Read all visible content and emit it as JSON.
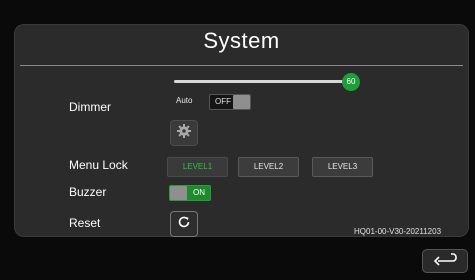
{
  "header": {
    "title": "System"
  },
  "dimmer": {
    "label": "Dimmer",
    "slider_value": "60",
    "level_fraction": 0.92,
    "auto_label": "Auto",
    "auto_toggle_text": "OFF",
    "settings_icon": "gear-icon"
  },
  "menu_lock": {
    "label": "Menu Lock",
    "levels": [
      "LEVEL1",
      "LEVEL2",
      "LEVEL3"
    ],
    "selected": "LEVEL1"
  },
  "buzzer": {
    "label": "Buzzer",
    "toggle_text": "ON"
  },
  "reset": {
    "label": "Reset",
    "icon": "refresh-icon"
  },
  "version": "HQ01-00-V30-20211203",
  "nav": {
    "back_icon": "return-arrow-icon"
  },
  "colors": {
    "accent_green": "#1e9e3a",
    "active_text_green": "#2fc244",
    "panel_bg": "#2b2b2b",
    "page_bg": "#0a0a0a"
  }
}
